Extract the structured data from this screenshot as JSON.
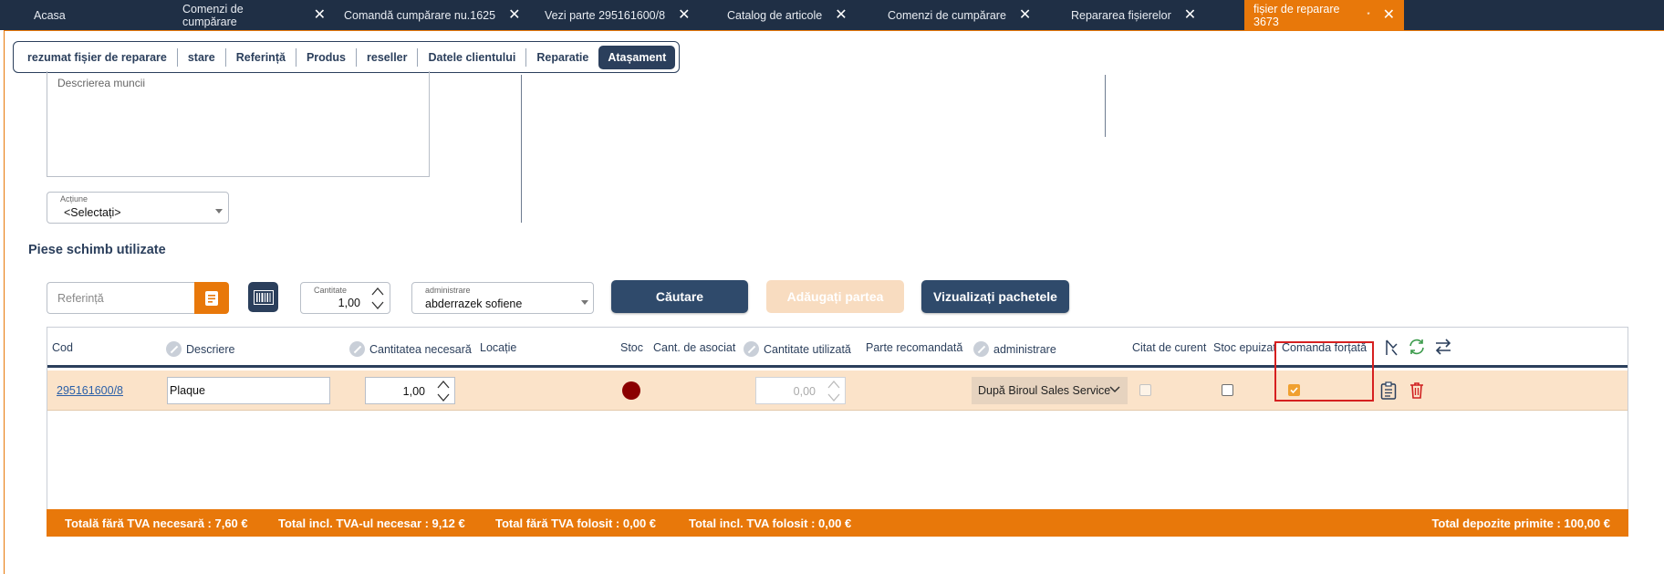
{
  "tabs": [
    {
      "label": "Acasa",
      "closable": false
    },
    {
      "label": "Comenzi de cumpărare",
      "closable": true
    },
    {
      "label": "Comandă cumpărare nu.1625",
      "closable": true
    },
    {
      "label": "Vezi parte 295161600/8",
      "closable": true
    },
    {
      "label": "Catalog de articole",
      "closable": true
    },
    {
      "label": "Comenzi de cumpărare",
      "closable": true
    },
    {
      "label": "Repararea fișierelor",
      "closable": true
    },
    {
      "label": "fișier de reparare 3673",
      "modified_mark": "*",
      "closable": true,
      "active": true
    }
  ],
  "section_nav": [
    "rezumat fișier de reparare",
    "stare",
    "Referință",
    "Produs",
    "reseller",
    "Datele clientului",
    "Reparatie",
    "Atașament"
  ],
  "work_description": {
    "placeholder": "Descrierea muncii"
  },
  "action": {
    "label": "Acțiune",
    "value": "<Selectați>"
  },
  "parts_section_title": "Piese schimb utilizate",
  "search": {
    "reference_placeholder": "Referință",
    "quantity_label": "Cantitate",
    "quantity_value": "1,00",
    "admin_label": "administrare",
    "admin_value": "abderrazek sofiene",
    "search_button": "Căutare",
    "add_part_button": "Adăugați partea",
    "view_packages_button": "Vizualizați pachetele"
  },
  "grid": {
    "headers": {
      "cod": "Cod",
      "descriere": "Descriere",
      "cantitatea_necesara": "Cantitatea necesară",
      "locatie": "Locație",
      "stoc": "Stoc",
      "cant_asociat": "Cant. de asociat",
      "cantitate_utilizata": "Cantitate utilizată",
      "parte_recomandata": "Parte recomandată",
      "administrare": "administrare",
      "citat_curent": "Citat de curent",
      "stoc_epuizat": "Stoc epuizat",
      "comanda_fortata": "Comanda forțată"
    },
    "rows": [
      {
        "cod": "295161600/8",
        "descriere": "Plaque",
        "cantitatea_necesara": "1,00",
        "stoc_status_color": "#8b0000",
        "cantitate_utilizata": "0,00",
        "administrare": "După Biroul Sales Service",
        "citat_curent": false,
        "stoc_epuizat": false,
        "comanda_fortata": true
      }
    ]
  },
  "totals": {
    "fara_tva_necesara": "Totală fără TVA necesară : 7,60 €",
    "incl_tva_necesar": "Total incl. TVA-ul necesar : 9,12 €",
    "fara_tva_folosit": "Total fără TVA folosit : 0,00 €",
    "incl_tva_folosit": "Total incl. TVA folosit : 0,00 €",
    "depozite": "Total depozite primite : 100,00 €"
  },
  "colors": {
    "navy": "#1f2f45",
    "accent": "#e8780a",
    "button": "#2f4a6b",
    "highlight": "#d62020"
  }
}
